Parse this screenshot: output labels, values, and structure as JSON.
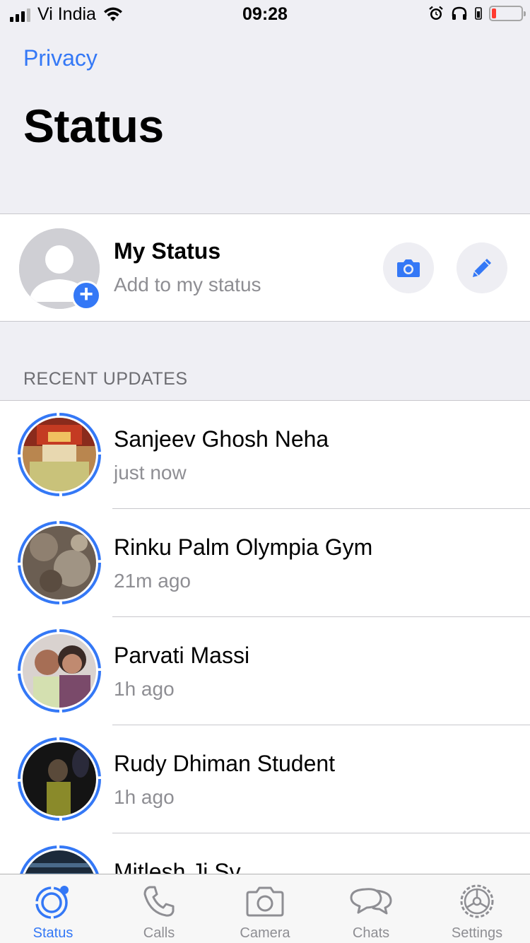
{
  "status_bar": {
    "carrier": "Vi India",
    "time": "09:28"
  },
  "header": {
    "back_label": "Privacy",
    "title": "Status"
  },
  "my_status": {
    "title": "My Status",
    "subtitle": "Add to my status"
  },
  "recent_updates": {
    "header": "RECENT UPDATES",
    "items": [
      {
        "name": "Sanjeev Ghosh Neha",
        "time": "just now"
      },
      {
        "name": "Rinku Palm Olympia Gym",
        "time": "21m ago"
      },
      {
        "name": "Parvati Massi",
        "time": "1h ago"
      },
      {
        "name": "Rudy Dhiman Student",
        "time": "1h ago"
      },
      {
        "name": "Mitlesh Ji Sv",
        "time": ""
      }
    ]
  },
  "tab_bar": {
    "tabs": [
      {
        "label": "Status",
        "icon": "status-icon",
        "active": true
      },
      {
        "label": "Calls",
        "icon": "phone-icon"
      },
      {
        "label": "Camera",
        "icon": "camera-icon"
      },
      {
        "label": "Chats",
        "icon": "chats-icon"
      },
      {
        "label": "Settings",
        "icon": "gear-icon"
      }
    ]
  },
  "colors": {
    "accent": "#3478f6",
    "ring": "#3478f6",
    "battery_low": "#ff3b30"
  }
}
